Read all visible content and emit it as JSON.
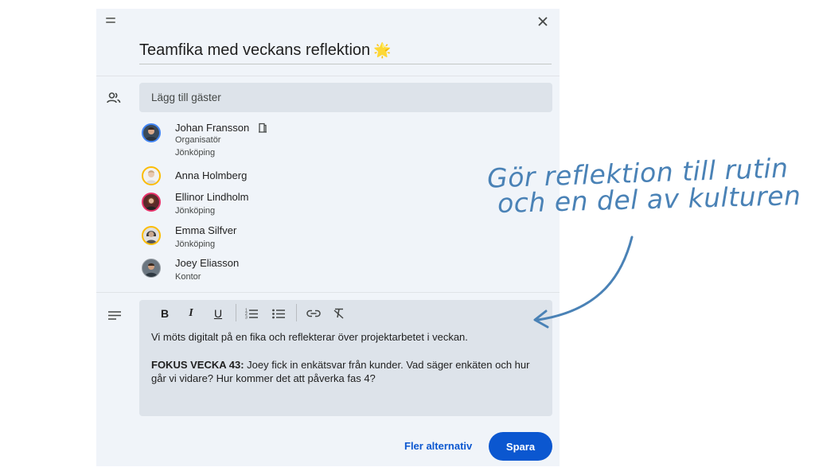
{
  "event": {
    "title": "Teamfika med veckans reflektion",
    "title_emoji": "🌟"
  },
  "guests": {
    "placeholder": "Lägg till gäster",
    "list": [
      {
        "name": "Johan Fransson",
        "role": "Organisatör",
        "location": "Jönköping",
        "icon": "room-icon"
      },
      {
        "name": "Anna Holmberg"
      },
      {
        "name": "Ellinor Lindholm",
        "location": "Jönköping"
      },
      {
        "name": "Emma Silfver",
        "location": "Jönköping"
      },
      {
        "name": "Joey Eliasson",
        "location": "Kontor"
      }
    ]
  },
  "toolbar": {
    "bold": "B",
    "italic": "I",
    "underline": "U",
    "buttons": [
      "bold",
      "italic",
      "underline",
      "numbered-list",
      "bulleted-list",
      "link",
      "clear-formatting"
    ]
  },
  "description": {
    "line1": "Vi möts digitalt på en fika och reflekterar över projektarbetet i veckan.",
    "focus_label": "FOKUS VECKA 43:",
    "focus_text": " Joey fick in enkätsvar från kunder. Vad säger enkäten och hur",
    "focus_text_2": "går vi vidare? Hur kommer det att påverka fas 4?"
  },
  "actions": {
    "more_options": "Fler alternativ",
    "save": "Spara"
  },
  "annotation": {
    "line1": "Gör reflektion till rutin",
    "line2": "och en del av kulturen",
    "color": "#4a82b6"
  },
  "colors": {
    "accent": "#0b57d0",
    "panel": "#f0f4f9",
    "field": "#dde3ea"
  }
}
